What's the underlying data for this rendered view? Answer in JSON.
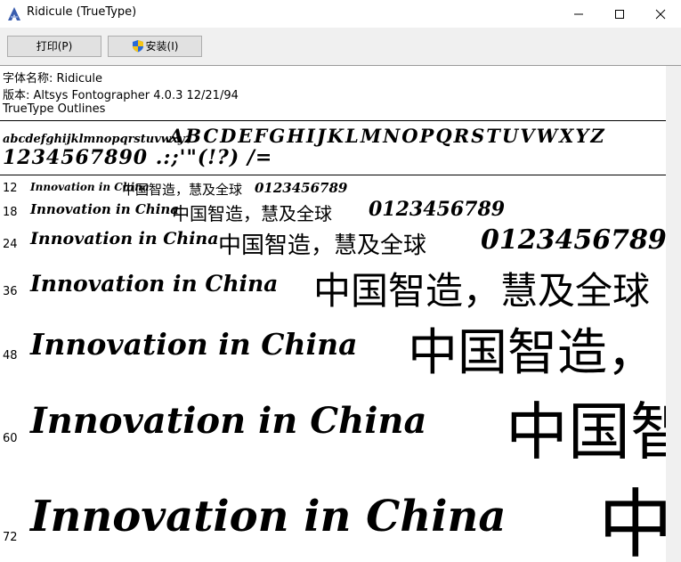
{
  "window": {
    "title": "Ridicule (TrueType)",
    "minimize_icon": "minimize-icon",
    "maximize_icon": "maximize-icon",
    "close_icon": "close-icon"
  },
  "toolbar": {
    "print_label": "打印(P)",
    "install_label": "安装(I)"
  },
  "font_info": {
    "name_line": "字体名称: Ridicule",
    "version_line": "版本: Altsys Fontographer 4.0.3 12/21/94",
    "type_line": "TrueType Outlines"
  },
  "character_set": {
    "lowercase": "abcdefghijklmnopqrstuvwxyz",
    "uppercase": "ABCDEFGHIJKLMNOPQRSTUVWXYZ",
    "digits_symbols": "1234567890 .:;'\"(!?) /="
  },
  "samples": [
    {
      "size": "12",
      "latin": "Innovation in China",
      "cjk": "中国智造，慧及全球",
      "digits": "0123456789"
    },
    {
      "size": "18",
      "latin": "Innovation in China",
      "cjk": "中国智造，慧及全球",
      "digits": "0123456789"
    },
    {
      "size": "24",
      "latin": "Innovation in China",
      "cjk": "中国智造，慧及全球",
      "digits": "0123456789"
    },
    {
      "size": "36",
      "latin": "Innovation in China",
      "cjk": "中国智造，慧及全球",
      "digits": ""
    },
    {
      "size": "48",
      "latin": "Innovation in China",
      "cjk": "中国智造，",
      "digits": ""
    },
    {
      "size": "60",
      "latin": "Innovation in China",
      "cjk": "中国智",
      "digits": ""
    },
    {
      "size": "72",
      "latin": "Innovation in China",
      "cjk": "中",
      "digits": ""
    }
  ]
}
